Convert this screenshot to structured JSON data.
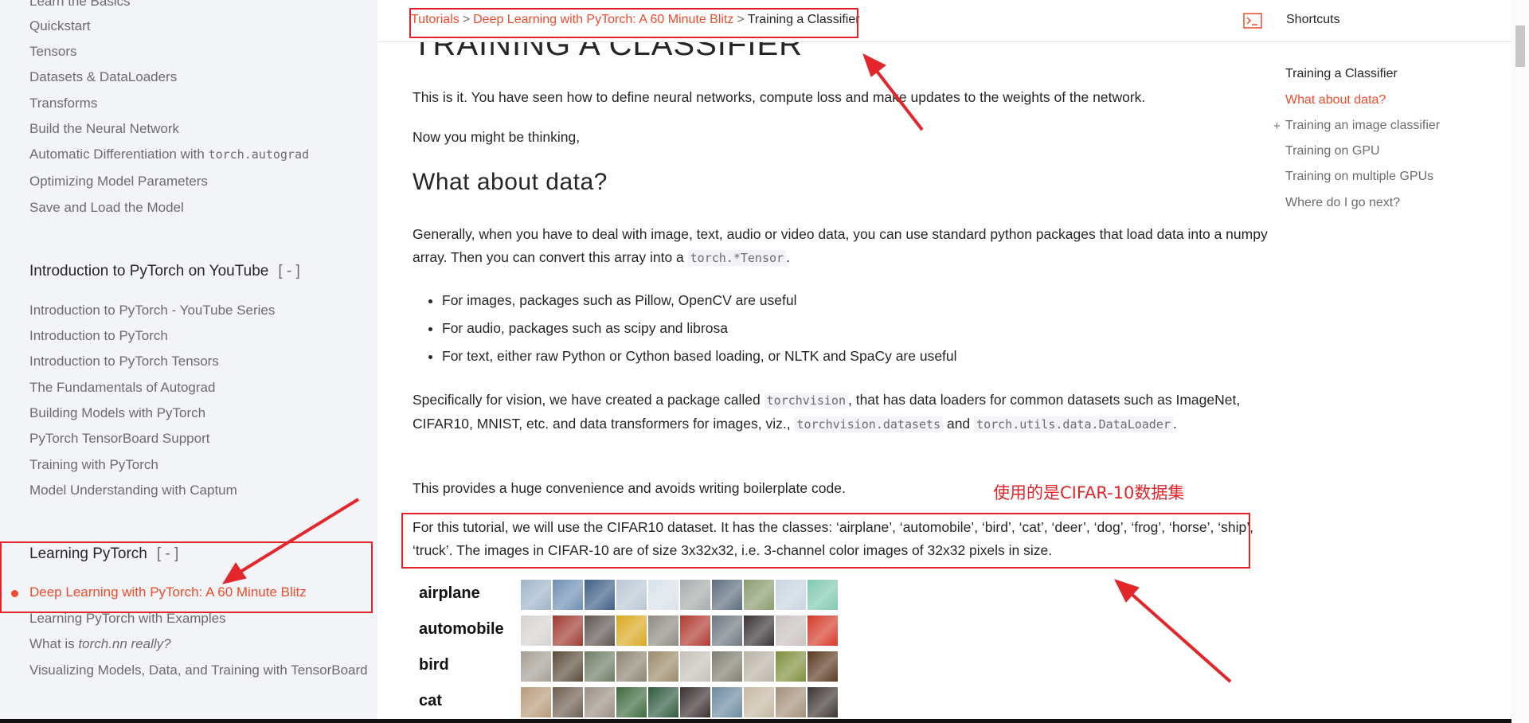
{
  "sidebar": {
    "items_top": [
      {
        "label": "Learn the Basics"
      },
      {
        "label": "Quickstart"
      },
      {
        "label": "Tensors"
      },
      {
        "label": "Datasets & DataLoaders"
      },
      {
        "label": "Transforms"
      },
      {
        "label": "Build the Neural Network"
      },
      {
        "label": "Automatic Differentiation with ",
        "code": "torch.autograd"
      },
      {
        "label": "Optimizing Model Parameters"
      },
      {
        "label": "Save and Load the Model"
      }
    ],
    "section_youtube": {
      "title": "Introduction to PyTorch on YouTube",
      "toggle": "[ - ]"
    },
    "items_youtube": [
      "Introduction to PyTorch - YouTube Series",
      "Introduction to PyTorch",
      "Introduction to PyTorch Tensors",
      "The Fundamentals of Autograd",
      "Building Models with PyTorch",
      "PyTorch TensorBoard Support",
      "Training with PyTorch",
      "Model Understanding with Captum"
    ],
    "section_learning": {
      "title": "Learning PyTorch",
      "toggle": "[ - ]"
    },
    "items_learning": [
      {
        "label": "Deep Learning with PyTorch: A 60 Minute Blitz",
        "active": true
      },
      {
        "label": "Learning PyTorch with Examples"
      },
      {
        "label_plain": "What is ",
        "label_italic": "torch.nn really?"
      },
      {
        "label": "Visualizing Models, Data, and Training with TensorBoard"
      }
    ]
  },
  "breadcrumb": {
    "tutorials": "Tutorials",
    "sep": ">",
    "blitz": "Deep Learning with PyTorch: A 60 Minute Blitz",
    "current": "Training a Classifier"
  },
  "shortcuts": {
    "label": "Shortcuts",
    "icon": "terminal-icon"
  },
  "content": {
    "title": "TRAINING A CLASSIFIER",
    "p1": "This is it. You have seen how to define neural networks, compute loss and make updates to the weights of the network.",
    "p2": "Now you might be thinking,",
    "h2": "What about data?",
    "p3_a": "Generally, when you have to deal with image, text, audio or video data, you can use standard python packages that load data into a numpy array. Then you can convert this array into a ",
    "p3_code": "torch.*Tensor",
    "p3_b": ".",
    "bullets": [
      "For images, packages such as Pillow, OpenCV are useful",
      "For audio, packages such as scipy and librosa",
      "For text, either raw Python or Cython based loading, or NLTK and SpaCy are useful"
    ],
    "p4_a": "Specifically for vision, we have created a package called ",
    "p4_code1": "torchvision",
    "p4_b": ", that has data loaders for common datasets such as ImageNet, CIFAR10, MNIST, etc. and data transformers for images, viz., ",
    "p4_code2": "torchvision.datasets",
    "p4_c": " and ",
    "p4_code3": "torch.utils.data.DataLoader",
    "p4_d": ".",
    "p5": "This provides a huge convenience and avoids writing boilerplate code.",
    "p6": "For this tutorial, we will use the CIFAR10 dataset. It has the classes: ‘airplane’, ‘automobile’, ‘bird’, ‘cat’, ‘deer’, ‘dog’, ‘frog’, ‘horse’, ‘ship’, ‘truck’. The images in CIFAR-10 are of size 3x32x32, i.e. 3-channel color images of 32x32 pixels in size.",
    "cifar_rows": [
      {
        "label": "airplane",
        "colors": [
          "#9fb4c9",
          "#6f8fb4",
          "#3f5f86",
          "#b9c7d4",
          "#d8e2ea",
          "#a7abab",
          "#5d6d7e",
          "#8a9b6f",
          "#c8d4e0",
          "#7fc9b0"
        ]
      },
      {
        "label": "automobile",
        "colors": [
          "#d6d2cf",
          "#9d3a2f",
          "#5d5550",
          "#d9a820",
          "#8e8a82",
          "#b0392e",
          "#6e7680",
          "#3a3336",
          "#c9c2c0",
          "#d43a2a"
        ]
      },
      {
        "label": "bird",
        "colors": [
          "#a59f94",
          "#5a4c3a",
          "#6e7d66",
          "#8c8472",
          "#9b8a6a",
          "#c6c0b8",
          "#7e7e70",
          "#b9b3a5",
          "#7f8f3c",
          "#5b3a22"
        ]
      },
      {
        "label": "cat",
        "colors": [
          "#b89a7a",
          "#6e5d50",
          "#9a8f85",
          "#3e6a3e",
          "#2f5b3f",
          "#3a3030",
          "#6c8aa0",
          "#c7b8a3",
          "#a48f7a",
          "#3d3430"
        ]
      }
    ]
  },
  "toc": {
    "title": "Training a Classifier",
    "items": [
      {
        "label": "What about data?",
        "active": true
      },
      {
        "label": "Training an image classifier",
        "expandable": true
      },
      {
        "label": "Training on GPU"
      },
      {
        "label": "Training on multiple GPUs"
      },
      {
        "label": "Where do I go next?"
      }
    ],
    "plus": "+"
  },
  "annotation": {
    "text": "使用的是CIFAR-10数据集",
    "color": "#e3262b"
  }
}
